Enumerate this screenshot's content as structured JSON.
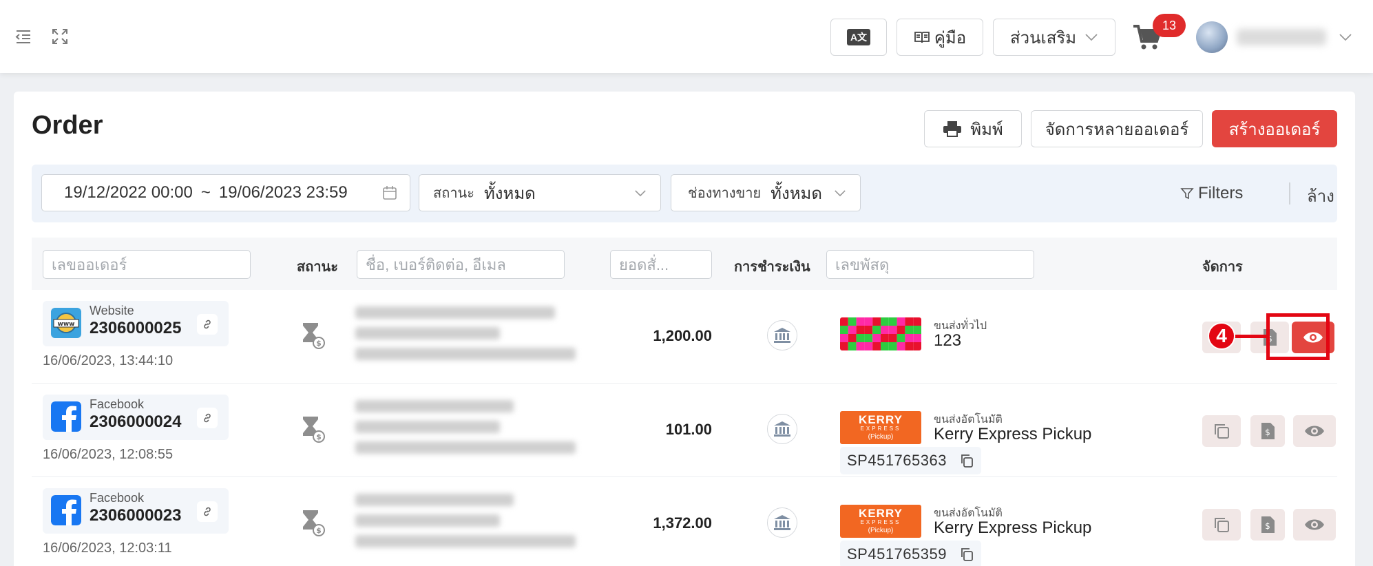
{
  "header": {
    "translate_label": "A文",
    "manual_label": "คู่มือ",
    "addons_label": "ส่วนเสริม",
    "cart_count": "13"
  },
  "page": {
    "title": "Order",
    "print_label": "พิมพ์",
    "bulk_label": "จัดการหลายออเดอร์",
    "create_label": "สร้างออเดอร์"
  },
  "filters": {
    "date_from": "19/12/2022 00:00",
    "date_sep": "~",
    "date_to": "19/06/2023 23:59",
    "status_label": "สถานะ",
    "status_value": "ทั้งหมด",
    "channel_label": "ช่องทางขาย",
    "channel_value": "ทั้งหมด",
    "filters_label": "Filters",
    "clear_label": "ล้าง"
  },
  "table": {
    "order_placeholder": "เลขออเดอร์",
    "status_header": "สถานะ",
    "customer_placeholder": "ชื่อ, เบอร์ติดต่อ, อีเมล",
    "amount_placeholder": "ยอดสั่...",
    "payment_header": "การชำระเงิน",
    "tracking_placeholder": "เลขพัสดุ",
    "manage_header": "จัดการ"
  },
  "rows": [
    {
      "channel": "Website",
      "order_no": "2306000025",
      "datetime": "16/06/2023, 13:44:10",
      "amount": "1,200.00",
      "ship_type": "ขนส่งทั่วไป",
      "ship_name": "123",
      "tracking": ""
    },
    {
      "channel": "Facebook",
      "order_no": "2306000024",
      "datetime": "16/06/2023, 12:08:55",
      "amount": "101.00",
      "ship_type": "ขนส่งอัตโนมัติ",
      "ship_name": "Kerry Express Pickup",
      "tracking": "SP451765363"
    },
    {
      "channel": "Facebook",
      "order_no": "2306000023",
      "datetime": "16/06/2023, 12:03:11",
      "amount": "1,372.00",
      "ship_type": "ขนส่งอัตโนมัติ",
      "ship_name": "Kerry Express Pickup",
      "tracking": "SP451765359"
    }
  ],
  "kerry_logo": {
    "line1": "KERRY",
    "line2": "EXPRESS",
    "line3": "(Pickup)"
  },
  "annotation": {
    "step": "4"
  },
  "colors": {
    "accent_red": "#e3453f",
    "highlight": "#e30613"
  }
}
